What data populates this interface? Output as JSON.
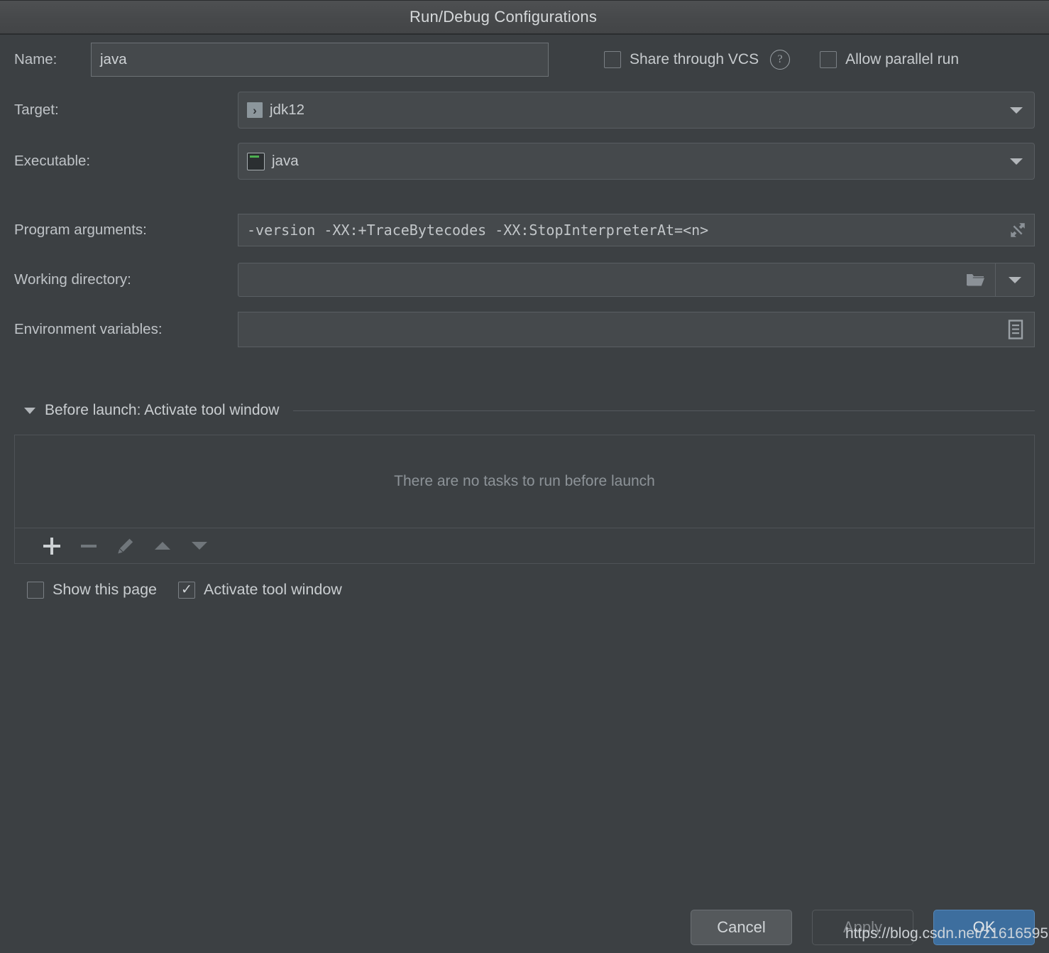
{
  "window": {
    "title": "Run/Debug Configurations"
  },
  "form": {
    "name_label": "Name:",
    "name_value": "java",
    "share_vcs_label": "Share through VCS",
    "share_vcs_checked": false,
    "help_glyph": "?",
    "allow_parallel_label": "Allow parallel run",
    "allow_parallel_checked": false,
    "target_label": "Target:",
    "target_value": "jdk12",
    "target_icon_glyph": "›",
    "executable_label": "Executable:",
    "executable_value": "java",
    "program_args_label": "Program arguments:",
    "program_args_value": "-version -XX:+TraceBytecodes -XX:StopInterpreterAt=<n>",
    "working_dir_label": "Working directory:",
    "working_dir_value": "",
    "working_dir_placeholder": "",
    "env_vars_label": "Environment variables:",
    "env_vars_value": "",
    "env_vars_placeholder": ""
  },
  "before_launch": {
    "title": "Before launch: Activate tool window",
    "empty_message": "There are no tasks to run before launch",
    "toolbar": {
      "add_title": "Add",
      "remove_title": "Remove",
      "edit_title": "Edit",
      "move_up_title": "Move Up",
      "move_down_title": "Move Down"
    },
    "show_page_label": "Show this page",
    "show_page_checked": false,
    "activate_tool_window_label": "Activate tool window",
    "activate_tool_window_checked": true
  },
  "footer": {
    "cancel_label": "Cancel",
    "apply_label": "Apply",
    "ok_label": "OK"
  },
  "watermark": {
    "text": "https://blog.csdn.net/z1616595"
  },
  "colors": {
    "window_bg": "#3c4043",
    "titlebar_bg": "#47494b",
    "field_bg": "#45494c",
    "text": "#bfc3c7",
    "muted_text": "#8d9398",
    "accent_ok": "#3d6e9e",
    "terminal_green": "#4caf50",
    "target_icon_bg": "#8c969c"
  }
}
